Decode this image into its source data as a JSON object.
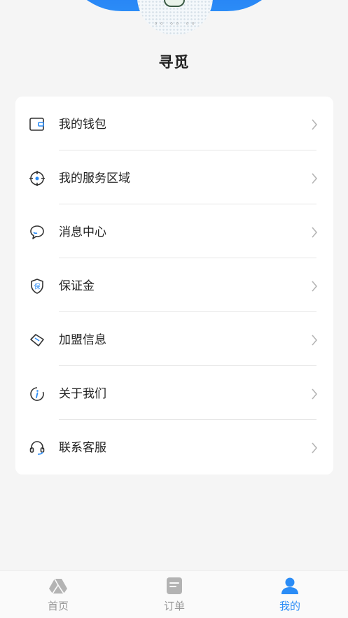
{
  "profile": {
    "nickname": "寻觅"
  },
  "menu": {
    "items": [
      {
        "label": "我的钱包",
        "icon": "wallet-icon"
      },
      {
        "label": "我的服务区域",
        "icon": "target-location-icon"
      },
      {
        "label": "消息中心",
        "icon": "chat-bubble-icon"
      },
      {
        "label": "保证金",
        "icon": "shield-deposit-icon"
      },
      {
        "label": "加盟信息",
        "icon": "tag-icon"
      },
      {
        "label": "关于我们",
        "icon": "info-icon"
      },
      {
        "label": "联系客服",
        "icon": "headset-icon"
      }
    ]
  },
  "tabbar": {
    "tabs": [
      {
        "label": "首页",
        "icon": "home-triangle-icon",
        "active": false
      },
      {
        "label": "订单",
        "icon": "order-doc-icon",
        "active": false
      },
      {
        "label": "我的",
        "icon": "user-icon",
        "active": true
      }
    ]
  },
  "colors": {
    "accent": "#2a8cf6",
    "headerBlue": "#1d6ff2",
    "inactive": "#999999"
  }
}
